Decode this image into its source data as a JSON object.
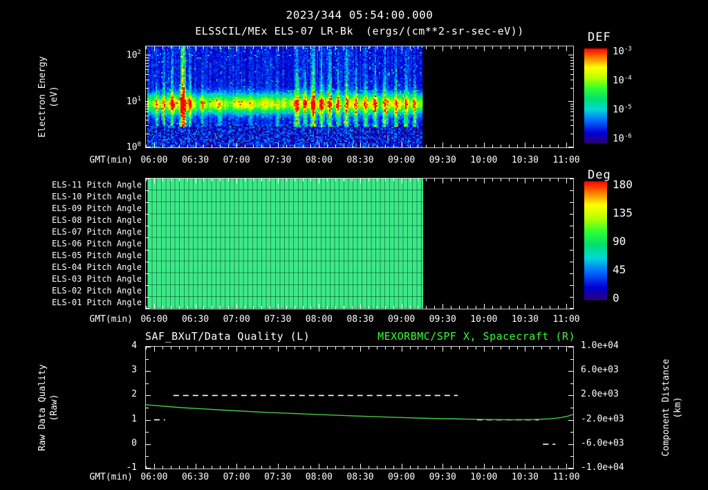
{
  "header": {
    "datetime": "2023/344 05:54:00.000"
  },
  "time_axis": {
    "label": "GMT(min)",
    "range_min": [
      354,
      665
    ],
    "ticks": [
      "06:00",
      "06:30",
      "07:00",
      "07:30",
      "08:00",
      "08:30",
      "09:00",
      "09:30",
      "10:00",
      "10:30",
      "11:00"
    ]
  },
  "colors": {
    "background": "#000000",
    "text": "#ffffff",
    "accent_green": "#33ff33",
    "curve_green": "#44cc44",
    "pitch_green": "#3ce987"
  },
  "chart_data": [
    {
      "type": "heatmap",
      "title": "ELSSCIL/MEx ELS-07 LR-Bk",
      "units": "(ergs/(cm**2-sr-sec-eV))",
      "xlabel": "GMT(min)",
      "ylabel_lines": [
        "Electron Energy",
        "(eV)"
      ],
      "y_scale": "log",
      "y_log_range": [
        0,
        2.2
      ],
      "y_ticks": [
        {
          "base": "10",
          "exp": "2"
        },
        {
          "base": "10",
          "exp": "1"
        },
        {
          "base": "10",
          "exp": "0"
        }
      ],
      "colorbar": {
        "label": "DEF",
        "ticks": [
          {
            "base": "10",
            "exp": "-3"
          },
          {
            "base": "10",
            "exp": "-4"
          },
          {
            "base": "10",
            "exp": "-5"
          },
          {
            "base": "10",
            "exp": "-6"
          }
        ]
      },
      "data_start_min": 355,
      "data_end_min": 556,
      "bottom_region": {
        "log_top": 0.5,
        "level": 0.18
      },
      "band": {
        "center_log": 0.95,
        "width_log": 0.2,
        "intensity": 0.5
      },
      "streaks": [
        {
          "t": 362,
          "w": 1.2,
          "a": 0.3
        },
        {
          "t": 367,
          "w": 1.3,
          "a": 0.45
        },
        {
          "t": 373,
          "w": 1.4,
          "a": 0.5
        },
        {
          "t": 381,
          "w": 2.2,
          "a": 1.0
        },
        {
          "t": 386,
          "w": 1.2,
          "a": 0.5
        },
        {
          "t": 395,
          "w": 1.2,
          "a": 0.25
        },
        {
          "t": 408,
          "w": 1.4,
          "a": 0.2
        },
        {
          "t": 430,
          "w": 1.4,
          "a": 0.18
        },
        {
          "t": 450,
          "w": 1.2,
          "a": 0.2
        },
        {
          "t": 464,
          "w": 1.8,
          "a": 0.6
        },
        {
          "t": 470,
          "w": 1.3,
          "a": 0.5
        },
        {
          "t": 476,
          "w": 1.8,
          "a": 0.72
        },
        {
          "t": 482,
          "w": 1.4,
          "a": 0.55
        },
        {
          "t": 488,
          "w": 1.6,
          "a": 0.65
        },
        {
          "t": 494,
          "w": 1.3,
          "a": 0.5
        },
        {
          "t": 500,
          "w": 1.5,
          "a": 0.55
        },
        {
          "t": 507,
          "w": 1.3,
          "a": 0.48
        },
        {
          "t": 514,
          "w": 1.5,
          "a": 0.42
        },
        {
          "t": 521,
          "w": 1.3,
          "a": 0.5
        },
        {
          "t": 528,
          "w": 1.6,
          "a": 0.55
        },
        {
          "t": 536,
          "w": 1.3,
          "a": 0.45
        },
        {
          "t": 543,
          "w": 1.5,
          "a": 0.5
        },
        {
          "t": 550,
          "w": 1.3,
          "a": 0.42
        }
      ],
      "colormap_stops": [
        [
          0.0,
          "#000018"
        ],
        [
          0.1,
          "#2a0070"
        ],
        [
          0.2,
          "#0000d8"
        ],
        [
          0.32,
          "#0070ff"
        ],
        [
          0.42,
          "#00d8d8"
        ],
        [
          0.52,
          "#00e070"
        ],
        [
          0.62,
          "#30ff30"
        ],
        [
          0.72,
          "#b8ff00"
        ],
        [
          0.82,
          "#ffff00"
        ],
        [
          0.91,
          "#ff8000"
        ],
        [
          1.0,
          "#ff0000"
        ]
      ]
    },
    {
      "type": "heatmap",
      "rows": [
        "ELS-11 Pitch Angle",
        "ELS-10 Pitch Angle",
        "ELS-09 Pitch Angle",
        "ELS-08 Pitch Angle",
        "ELS-07 Pitch Angle",
        "ELS-06 Pitch Angle",
        "ELS-05 Pitch Angle",
        "ELS-04 Pitch Angle",
        "ELS-03 Pitch Angle",
        "ELS-02 Pitch Angle",
        "ELS-01 Pitch Angle"
      ],
      "xlabel": "GMT(min)",
      "colorbar": {
        "label": "Deg",
        "ticks": [
          "180",
          "135",
          "90",
          "45",
          "0"
        ],
        "range_deg": [
          0,
          180
        ]
      },
      "data_start_min": 355,
      "data_end_min": 556,
      "value_deg": 100,
      "fill_color": "#3ce987"
    },
    {
      "type": "line",
      "title_left": "SAF_BXuT/Data Quality (L)",
      "title_right": "MEXORBMC/SPF X, Spacecraft (R)",
      "xlabel": "GMT(min)",
      "y_left": {
        "label_lines": [
          "Raw Data Quality",
          "(Raw)"
        ],
        "range": [
          -1,
          4
        ],
        "ticks": [
          "4",
          "3",
          "2",
          "1",
          "0",
          "-1"
        ]
      },
      "y_right": {
        "label_lines": [
          "Component Distance",
          "(km)"
        ],
        "range": [
          -10000,
          10000
        ],
        "ticks": [
          "1.0e+04",
          "6.0e+03",
          "2.0e+03",
          "-2.0e+03",
          "-6.0e+03",
          "-1.0e+04"
        ]
      },
      "series": [
        {
          "name": "SAF_BXuT Data Quality",
          "axis": "left",
          "color": "#ffffff",
          "style": "dashed",
          "segments": [
            {
              "value": 1,
              "t_start": 360,
              "t_end": 368
            },
            {
              "value": 2,
              "t_start": 374,
              "t_end": 581
            },
            {
              "value": 1,
              "t_start": 595,
              "t_end": 640
            },
            {
              "value": 0,
              "t_start": 643,
              "t_end": 652
            }
          ]
        },
        {
          "name": "MEXORBMC/SPF X Spacecraft",
          "axis": "right",
          "color": "#44cc44",
          "style": "solid",
          "points": [
            [
              354,
              480
            ],
            [
              380,
              0
            ],
            [
              410,
              -400
            ],
            [
              440,
              -760
            ],
            [
              470,
              -1040
            ],
            [
              500,
              -1320
            ],
            [
              530,
              -1560
            ],
            [
              560,
              -1760
            ],
            [
              585,
              -1880
            ],
            [
              605,
              -1960
            ],
            [
              620,
              -2000
            ],
            [
              635,
              -1960
            ],
            [
              648,
              -1840
            ],
            [
              656,
              -1640
            ],
            [
              661,
              -1400
            ],
            [
              665,
              -1120
            ]
          ]
        }
      ]
    }
  ]
}
